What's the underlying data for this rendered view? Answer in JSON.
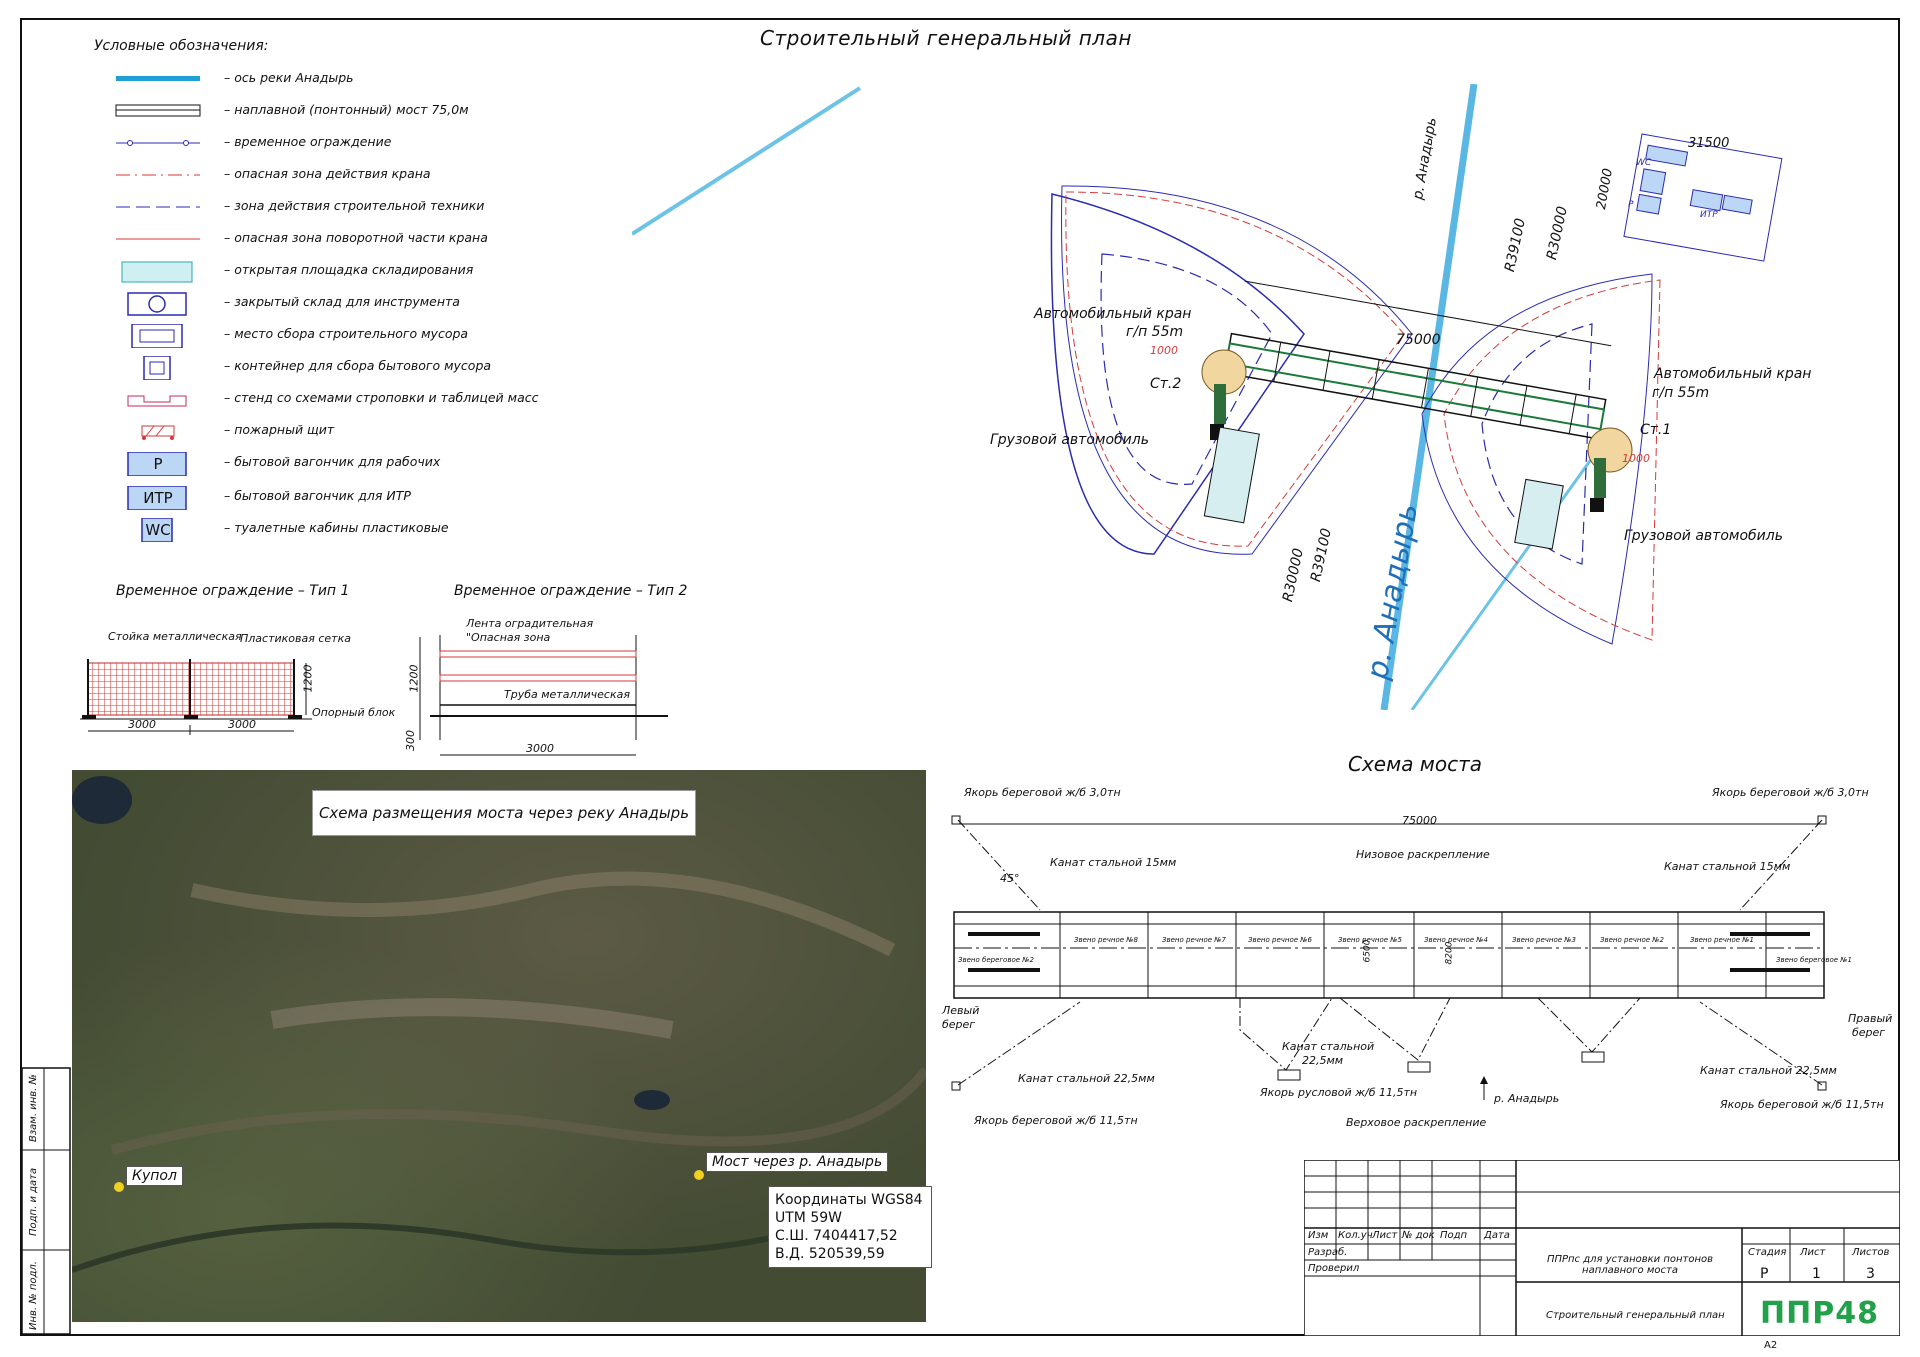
{
  "title": "Строительный генеральный план",
  "legend": {
    "heading": "Условные обозначения:",
    "items": [
      {
        "icon": "river-axis-icon",
        "text": "– ось реки Анадырь"
      },
      {
        "icon": "pontoon-bridge-icon",
        "text": "– наплавной (понтонный) мост 75,0м"
      },
      {
        "icon": "temporary-fence-icon",
        "text": "– временное ограждение"
      },
      {
        "icon": "crane-danger-zone-icon",
        "text": "– опасная зона действия крана"
      },
      {
        "icon": "machinery-zone-icon",
        "text": "– зона действия строительной техники"
      },
      {
        "icon": "crane-rotation-zone-icon",
        "text": "– опасная зона поворотной части крана"
      },
      {
        "icon": "storage-area-icon",
        "text": "– открытая площадка складирования"
      },
      {
        "icon": "tool-storage-icon",
        "text": "– закрытый склад для инструмента"
      },
      {
        "icon": "debris-collection-icon",
        "text": "– место сбора строительного мусора"
      },
      {
        "icon": "waste-container-icon",
        "text": "– контейнер для сбора бытового мусора"
      },
      {
        "icon": "slinging-stand-icon",
        "text": "– стенд со схемами строповки и таблицей масс"
      },
      {
        "icon": "fire-board-icon",
        "text": "– пожарный щит"
      },
      {
        "icon": "worker-trailer-icon",
        "label": "Р",
        "text": "– бытовой вагончик для рабочих"
      },
      {
        "icon": "itr-trailer-icon",
        "label": "ИТР",
        "text": "– бытовой вагончик для ИТР"
      },
      {
        "icon": "toilet-icon",
        "label": "WC",
        "text": "– туалетные кабины пластиковые"
      }
    ]
  },
  "fence1": {
    "title": "Временное ограждение – Тип 1",
    "post": "Стойка металлическая",
    "mesh": "Пластиковая сетка",
    "height": "1200",
    "base": "Опорный блок",
    "span1": "3000",
    "span2": "3000"
  },
  "fence2": {
    "title": "Временное ограждение – Тип 2",
    "tape": "Лента оградительная",
    "tape2": "\"Опасная зона",
    "pipe": "Труба металлическая",
    "h1": "1200",
    "h2": "300",
    "span": "3000"
  },
  "plan": {
    "river_top": "р. Анадырь",
    "river_big": "р. Анадырь",
    "crane_left": "Автомобильный кран",
    "crane_left_cap": "г/п 55m",
    "crane_right": "Автомобильный кран",
    "crane_right_cap": "г/п 55m",
    "st2": "Ст.2",
    "st1": "Ст.1",
    "truck_left": "Грузовой автомобиль",
    "truck_right": "Грузовой автомобиль",
    "span": "75000",
    "r1": "R39100",
    "r2": "R30000",
    "r3": "R39100",
    "r4": "R30000",
    "d1000a": "1000",
    "d1000b": "1000",
    "site_w": "31500",
    "site_h": "20000",
    "site_itr": "ИТР",
    "site_p": "Р",
    "site_wc": "WC"
  },
  "satellite": {
    "title": "Схема размещения моста через реку Анадырь",
    "kupol": "Купол",
    "bridge": "Мост через р. Анадырь",
    "coords": [
      "Координаты WGS84",
      "UTM 59W",
      "С.Ш. 7404417,52",
      "В.Д. 520539,59"
    ]
  },
  "bridge_scheme": {
    "title": "Схема моста",
    "span": "75000",
    "anchor_tl": "Якорь береговой ж/б 3,0тн",
    "anchor_tr": "Якорь береговой ж/б 3,0тн",
    "anchor_bl": "Якорь береговой ж/б 11,5тн",
    "anchor_br": "Якорь береговой ж/б 11,5тн",
    "cable_tl": "Канат стальной 15мм",
    "cable_tr": "Канат стальной 15мм",
    "cable_bl": "Канат стальной 22,5мм",
    "cable_br": "Канат стальной 22,5мм",
    "cable_mid": "Канат стальной",
    "cable_mid2": "22,5мм",
    "anchor_mid": "Якорь русловой ж/б 11,5тн",
    "river": "р. Анадырь",
    "lower": "Низовое раскрепление",
    "upper": "Верховое раскрепление",
    "left_bank": "Левый",
    "left_bank2": "берег",
    "right_bank": "Правый",
    "right_bank2": "берег",
    "angle": "45°",
    "w6500": "6500",
    "w8200": "8200",
    "links": [
      "Звено береговое №2",
      "Звено речное №8",
      "Звено речное №7",
      "Звено речное №6",
      "Звено речное №5",
      "Звено речное №4",
      "Звено речное №3",
      "Звено речное №2",
      "Звено речное №1",
      "Звено береговое №1"
    ]
  },
  "title_block": {
    "cols": [
      "Изм",
      "Кол.уч",
      "Лист",
      "№ док",
      "Подп",
      "Дата"
    ],
    "dev": "Разраб.",
    "check": "Проверил",
    "project": "ППРпс для установки понтонов наплавного моста",
    "sheet_name": "Строительный генеральный план",
    "stage_h": "Стадия",
    "sheet_h": "Лист",
    "sheets_h": "Листов",
    "stage": "Р",
    "sheet": "1",
    "sheets": "3",
    "logo": "ППР48",
    "format": "А2"
  },
  "side": {
    "inv": "Инв. № подл.",
    "sign": "Подп. и дата",
    "vzam": "Взам. инв. №"
  },
  "colors": {
    "river": "#1f9fd4",
    "danger": "#d43a3a",
    "zone": "#2b2bb0",
    "logo": "#22a14a"
  }
}
